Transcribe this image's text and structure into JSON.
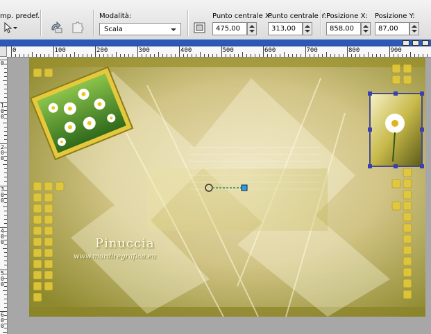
{
  "tool_options": {
    "preset_label": "mp. predef.:",
    "mode_label": "Modalità:",
    "mode_value": "Scala",
    "center_x_label": "Punto centrale X:",
    "center_x_value": "475,00",
    "center_y_label": "Punto centrale Y:",
    "center_y_value": "313,00",
    "pos_x_label": "Posizione X:",
    "pos_x_value": "858,00",
    "pos_y_label": "Posizione Y:",
    "pos_y_value": "87,00"
  },
  "ruler": {
    "h_labels": [
      "0",
      "100",
      "200",
      "300",
      "400",
      "500",
      "600",
      "700",
      "800",
      "900"
    ],
    "v_labels": [
      "0",
      "1\n0\n0",
      "2\n0\n0",
      "3\n0\n0",
      "4\n0\n0",
      "5\n0\n0",
      "6\n0\n0"
    ]
  },
  "artwork": {
    "watermark_name": "Pinuccia",
    "watermark_url": "www.mardiregrafica.eu"
  },
  "colors": {
    "accent_yellow": "#e6cc3a",
    "olive": "#8c8a2e",
    "title_blue": "#2d58b8"
  }
}
